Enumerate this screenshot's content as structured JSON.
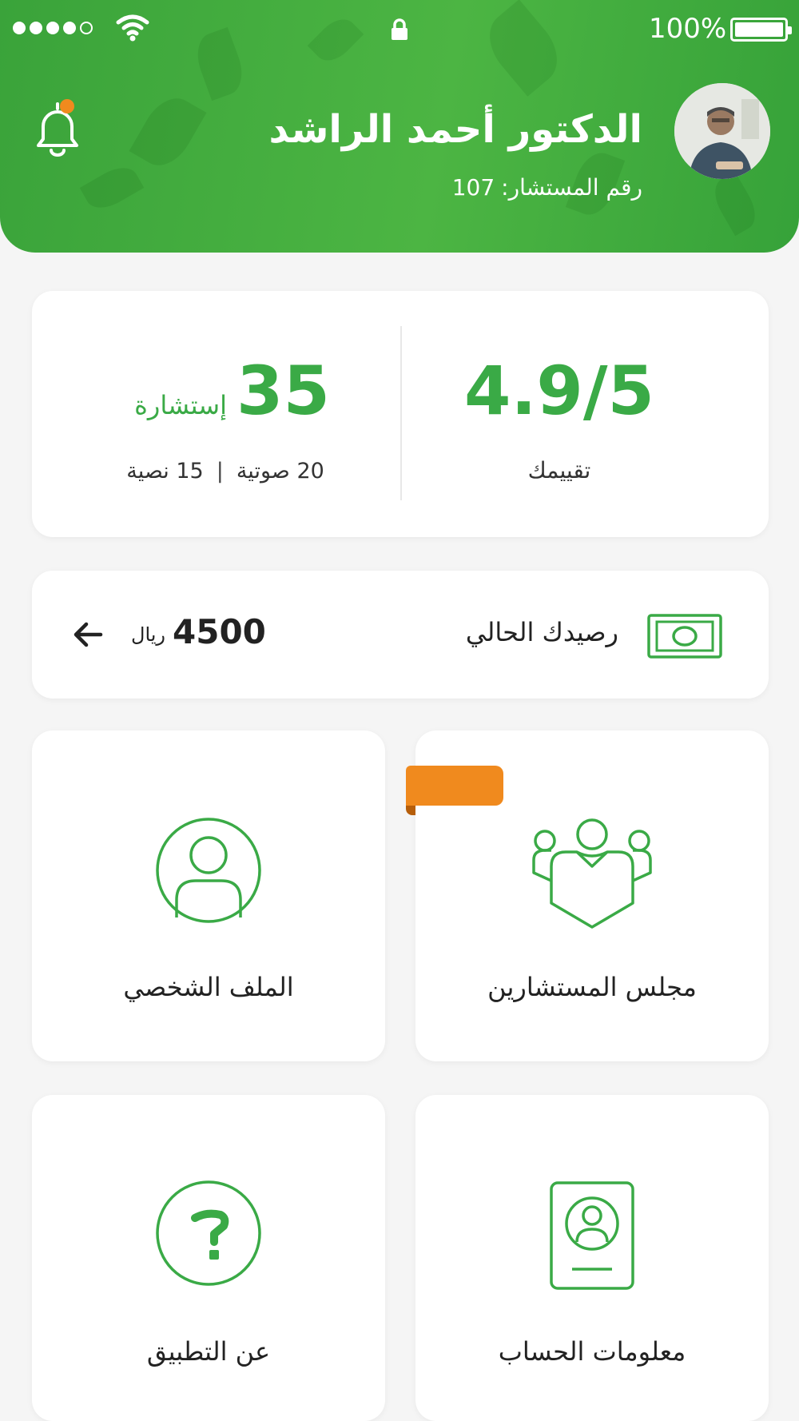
{
  "status_bar": {
    "battery": "100%"
  },
  "header": {
    "name": "الدكتور أحمد الراشد",
    "consultant_label": "رقم المستشار:",
    "consultant_number": "107"
  },
  "stats": {
    "rating_value": "4.9/5",
    "rating_label": "تقييمك",
    "consult_count": "35",
    "consult_word": "إستشارة",
    "voice": "20 صوتية",
    "text": "15 نصية",
    "separator": "|"
  },
  "balance": {
    "label": "رصيدك الحالي",
    "amount": "4500",
    "currency": "ريال"
  },
  "tiles": {
    "advisors": "مجلس المستشارين",
    "profile": "الملف الشخصي",
    "account": "معلومات الحساب",
    "about": "عن التطبيق"
  },
  "colors": {
    "brand_green": "#3aaa46",
    "accent_orange": "#f08a1e"
  }
}
